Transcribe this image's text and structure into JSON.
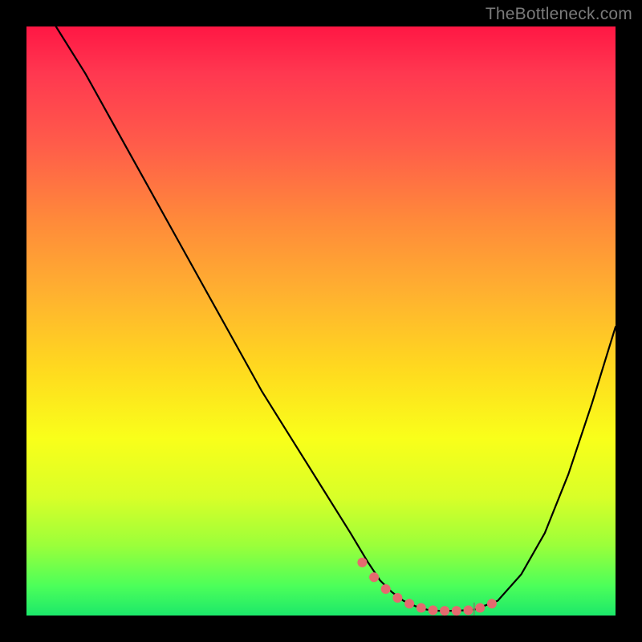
{
  "watermark": "TheBottleneck.com",
  "colors": {
    "frame": "#000000",
    "curve": "#000000",
    "markers": "#e46a6f",
    "axis_marker": "#62a265"
  },
  "chart_data": {
    "type": "line",
    "title": "",
    "xlabel": "",
    "ylabel": "",
    "xlim": [
      0,
      100
    ],
    "ylim": [
      0,
      100
    ],
    "series": [
      {
        "name": "bottleneck-curve",
        "x": [
          5,
          10,
          15,
          20,
          25,
          30,
          35,
          40,
          45,
          50,
          55,
          58,
          60,
          62,
          64,
          66,
          68,
          70,
          73,
          76,
          80,
          84,
          88,
          92,
          96,
          100
        ],
        "y": [
          100,
          92,
          83,
          74,
          65,
          56,
          47,
          38,
          30,
          22,
          14,
          9,
          6,
          4,
          2.5,
          1.6,
          1.0,
          0.8,
          0.8,
          1.0,
          2.5,
          7,
          14,
          24,
          36,
          49
        ]
      }
    ],
    "markers": {
      "name": "trough-markers",
      "x": [
        57,
        59,
        61,
        63,
        65,
        67,
        69,
        71,
        73,
        75,
        77,
        79
      ],
      "y": [
        9.0,
        6.5,
        4.5,
        3.0,
        2.0,
        1.3,
        0.9,
        0.8,
        0.8,
        0.9,
        1.3,
        2.0
      ]
    },
    "axis_tick": {
      "x": 76,
      "y_from": 0,
      "y_to": 2.2
    }
  }
}
